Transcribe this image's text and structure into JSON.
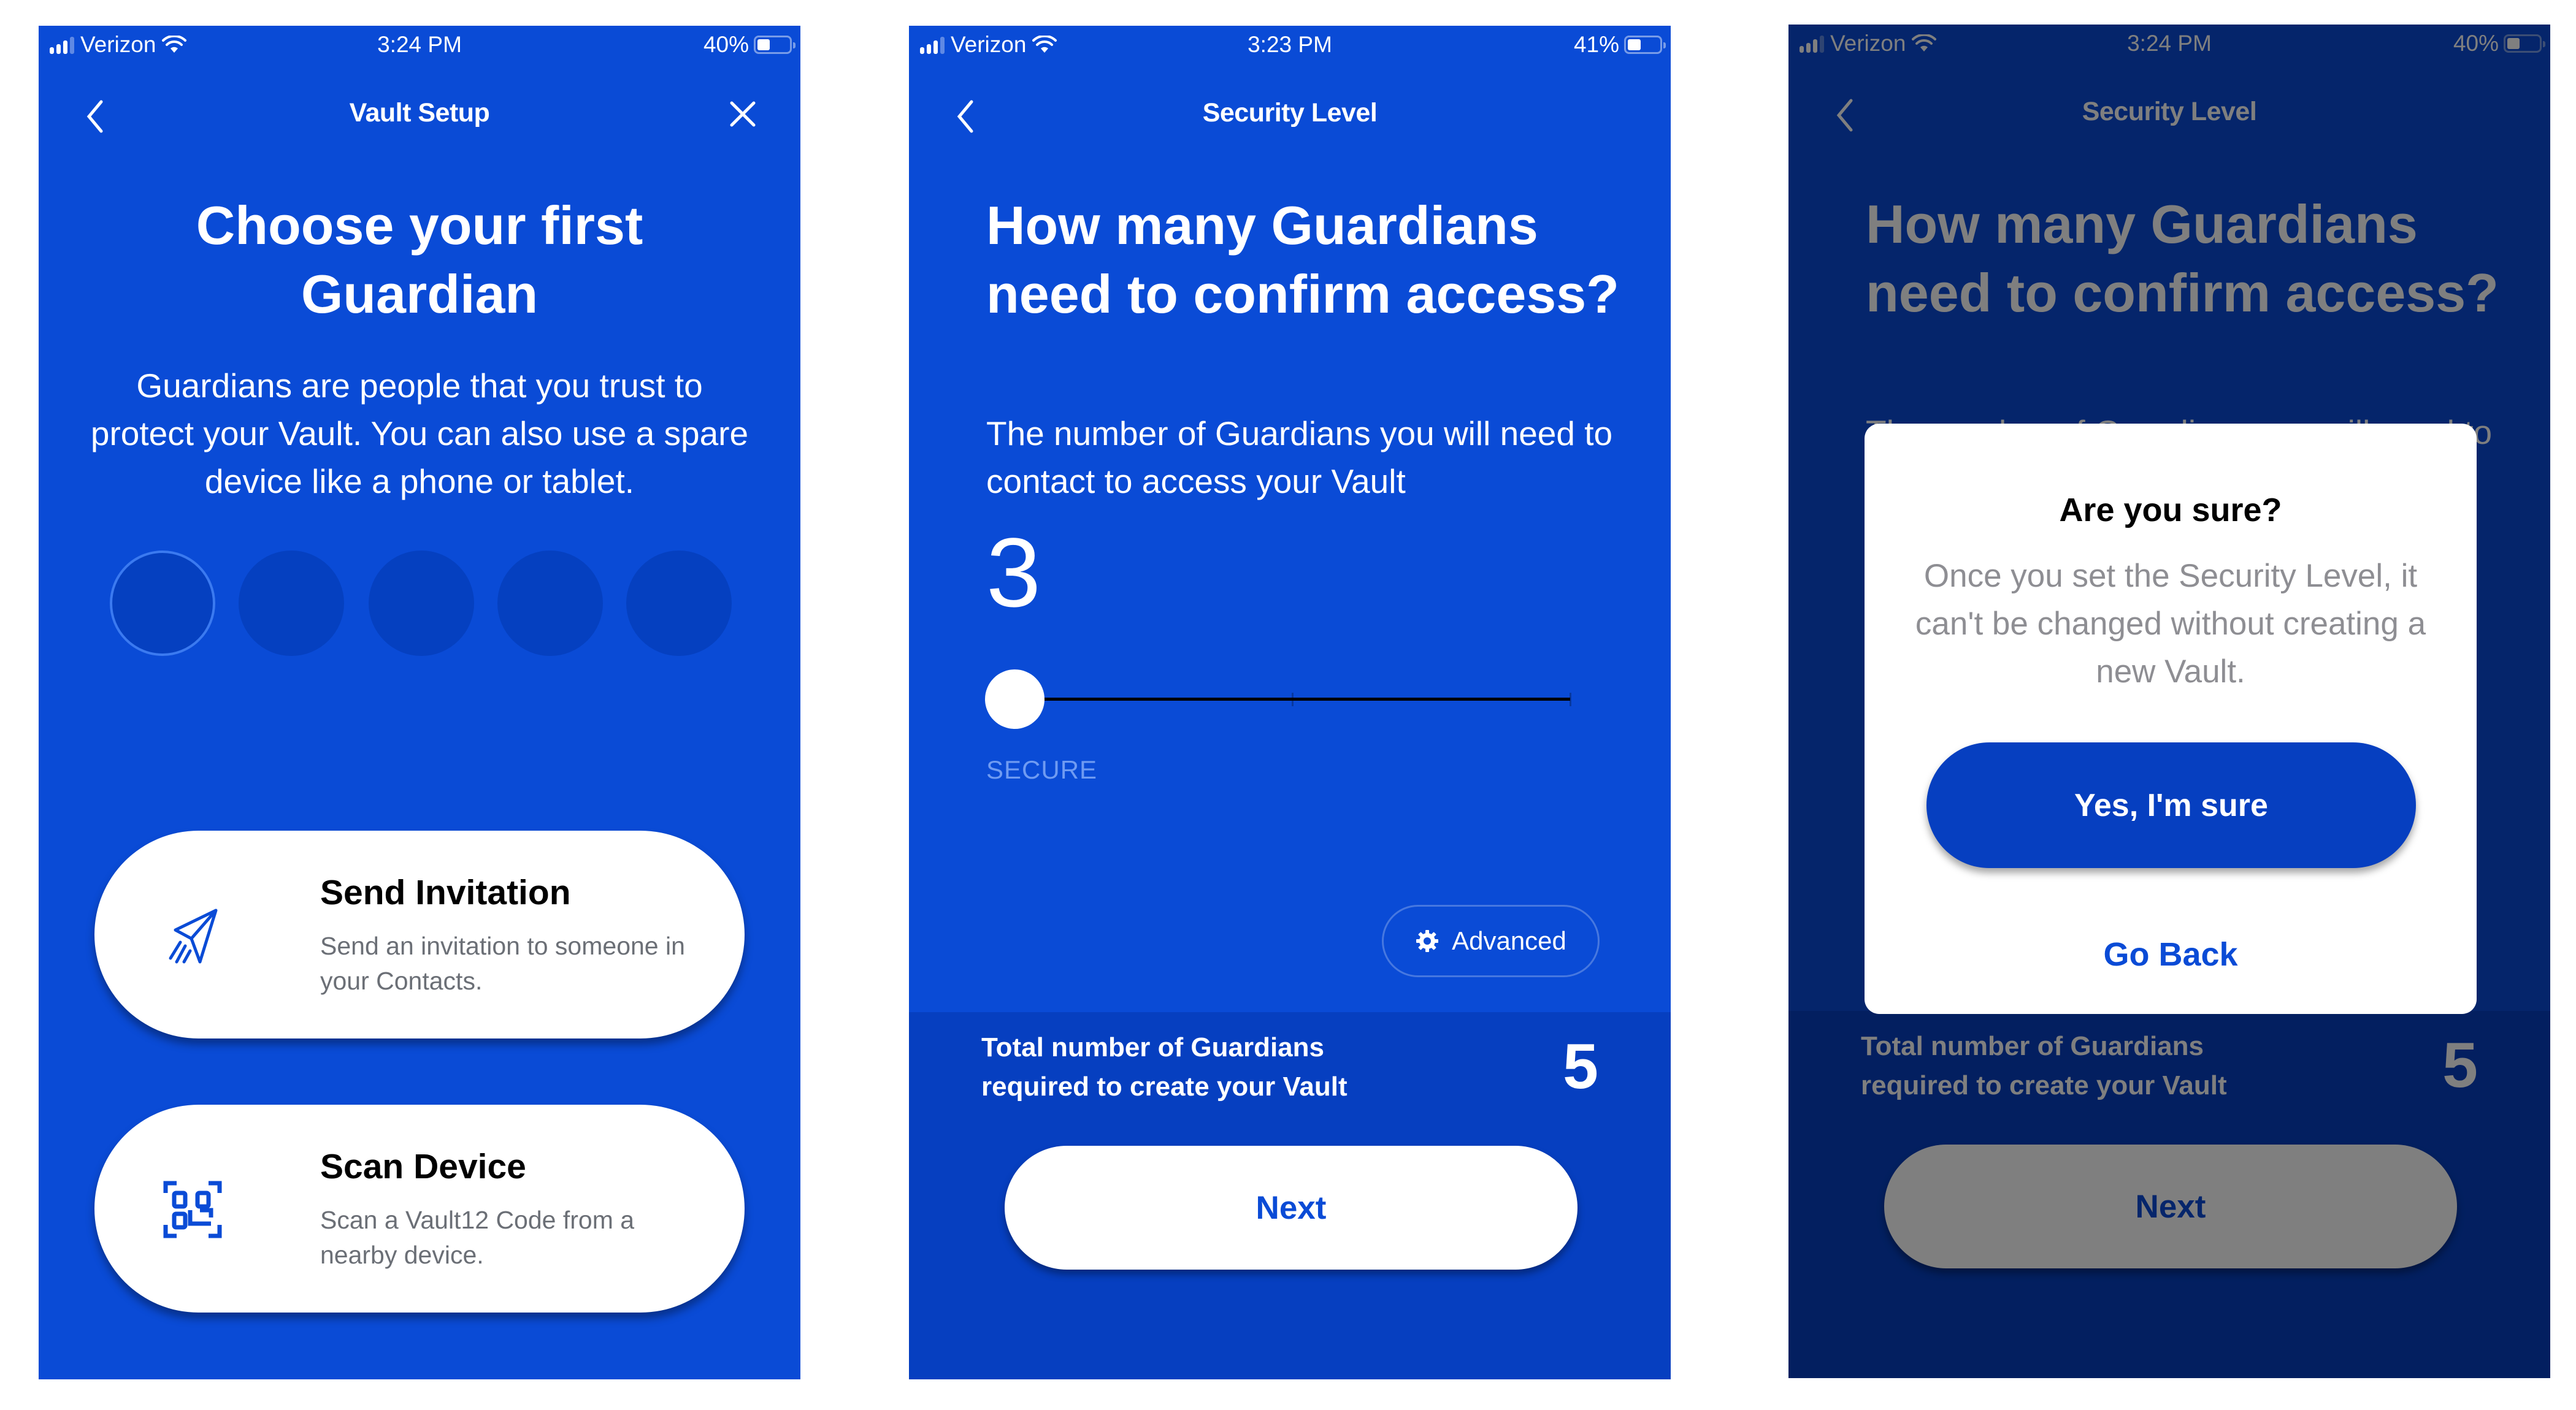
{
  "colors": {
    "brand_blue": "#0a4bd6",
    "bottom_panel_blue": "#063fc0",
    "dimmed_overlay": "rgba(0,0,0,0.5)",
    "secure_label": "#6f9bf2",
    "white": "#ffffff"
  },
  "screens": [
    {
      "status": {
        "carrier": "Verizon",
        "time": "3:24 PM",
        "battery": "40%",
        "battery_level": 0.4
      },
      "nav": {
        "title": "Vault Setup",
        "back_icon": "chevron-left-icon",
        "close_icon": "close-icon"
      },
      "title": "Choose your first Guardian",
      "description": "Guardians are people that you trust to protect your Vault. You can also use a spare device like a phone or tablet.",
      "guardian_slots": {
        "total": 5,
        "active_index": 0
      },
      "options": [
        {
          "icon": "paper-plane-icon",
          "title": "Send Invitation",
          "description": "Send an invitation to someone in your Contacts."
        },
        {
          "icon": "qr-code-icon",
          "title": "Scan Device",
          "description": "Scan a Vault12 Code from a nearby device."
        }
      ]
    },
    {
      "status": {
        "carrier": "Verizon",
        "time": "3:23 PM",
        "battery": "41%",
        "battery_level": 0.41
      },
      "nav": {
        "title": "Security Level",
        "back_icon": "chevron-left-icon"
      },
      "title": "How many Guardians need to confirm access?",
      "description": "The number of Guardians you will need to contact to access your Vault",
      "selected_count": "3",
      "slider": {
        "value": 3,
        "min": 3,
        "max": 5
      },
      "slider_label": "SECURE",
      "advanced_label": "Advanced",
      "total_label": "Total number of Guardians required to create your Vault",
      "total_value": "5",
      "next_label": "Next"
    },
    {
      "status": {
        "carrier": "Verizon",
        "time": "3:24 PM",
        "battery": "40%",
        "battery_level": 0.4
      },
      "nav": {
        "title": "Security Level",
        "back_icon": "chevron-left-icon"
      },
      "title": "How many Guardians need to confirm access?",
      "description": "The number of Guardians you will need to contact to access your Vault",
      "total_label": "Total number of Guardians required to create your Vault",
      "total_value": "5",
      "next_label": "Next",
      "modal": {
        "title": "Are you sure?",
        "body": "Once you set the Security Level, it can't be changed without creating a new Vault.",
        "confirm_label": "Yes, I'm sure",
        "cancel_label": "Go Back"
      }
    }
  ]
}
